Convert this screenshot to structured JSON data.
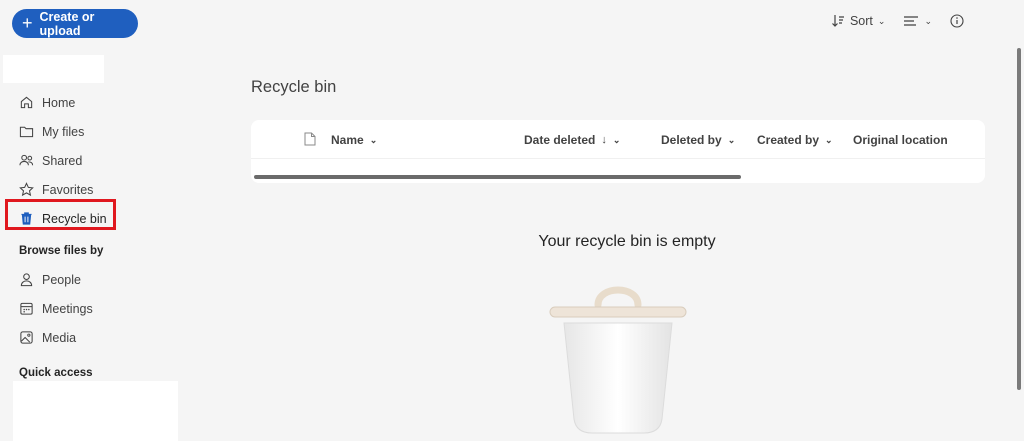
{
  "header": {
    "create_label": "Create or upload",
    "sort_label": "Sort"
  },
  "nav": {
    "items": [
      {
        "label": "Home",
        "icon": "home-icon"
      },
      {
        "label": "My files",
        "icon": "folder-icon"
      },
      {
        "label": "Shared",
        "icon": "people-icon"
      },
      {
        "label": "Favorites",
        "icon": "star-icon"
      },
      {
        "label": "Recycle bin",
        "icon": "trash-icon",
        "active": true
      }
    ],
    "browse_heading": "Browse files by",
    "browse_items": [
      {
        "label": "People",
        "icon": "person-icon"
      },
      {
        "label": "Meetings",
        "icon": "calendar-icon"
      },
      {
        "label": "Media",
        "icon": "image-icon"
      }
    ],
    "quick_access_heading": "Quick access"
  },
  "main": {
    "title": "Recycle bin",
    "columns": {
      "name": "Name",
      "date_deleted": "Date deleted",
      "deleted_by": "Deleted by",
      "created_by": "Created by",
      "original_location": "Original location"
    },
    "empty_message": "Your recycle bin is empty"
  },
  "colors": {
    "accent": "#1f5fbf",
    "highlight": "#e0181f",
    "background": "#f5f5f5"
  }
}
